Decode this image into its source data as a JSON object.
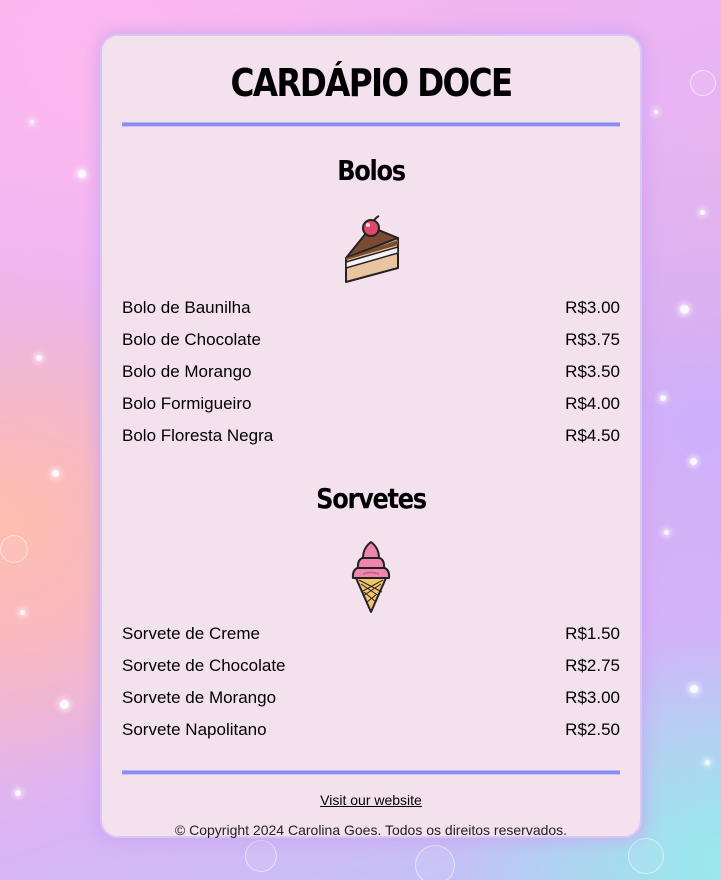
{
  "menu": {
    "title": "CARDÁPIO DOCE",
    "sections": [
      {
        "title": "Bolos",
        "icon": "cake-slice-icon",
        "items": [
          {
            "name": "Bolo de Baunilha",
            "price": "R$3.00"
          },
          {
            "name": "Bolo de Chocolate",
            "price": "R$3.75"
          },
          {
            "name": "Bolo de Morango",
            "price": "R$3.50"
          },
          {
            "name": "Bolo Formigueiro",
            "price": "R$4.00"
          },
          {
            "name": "Bolo Floresta Negra",
            "price": "R$4.50"
          }
        ]
      },
      {
        "title": "Sorvetes",
        "icon": "ice-cream-cone-icon",
        "items": [
          {
            "name": "Sorvete de Creme",
            "price": "R$1.50"
          },
          {
            "name": "Sorvete de Chocolate",
            "price": "R$2.75"
          },
          {
            "name": "Sorvete de Morango",
            "price": "R$3.00"
          },
          {
            "name": "Sorvete Napolitano",
            "price": "R$2.50"
          }
        ]
      }
    ]
  },
  "footer": {
    "link_text": "Visit our website",
    "copyright": "© Copyright 2024 Carolina Goes. Todos os direitos reservados."
  },
  "colors": {
    "card_background": "#f4e1ee",
    "divider": "#8a8ef2",
    "card_border": "#d9c6f4"
  }
}
